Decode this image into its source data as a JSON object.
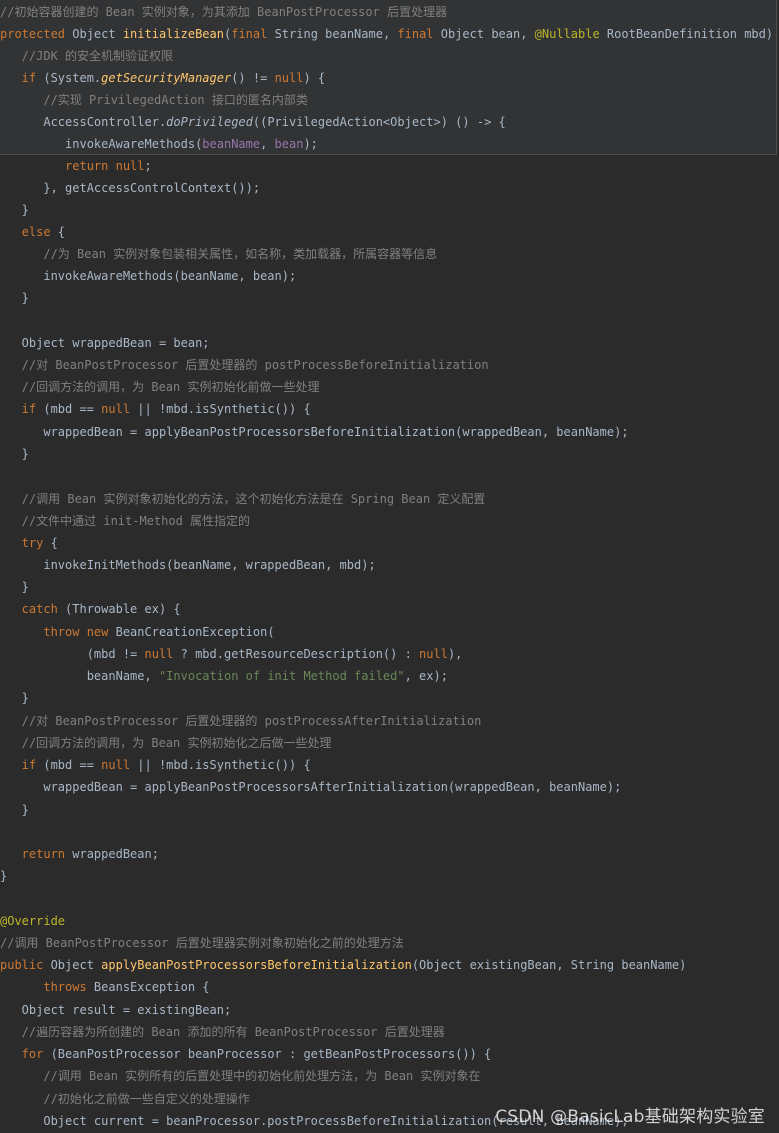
{
  "lines": [
    {
      "c": "comment",
      "t": "//初始容器创建的 Bean 实例对象，为其添加 BeanPostProcessor 后置处理器"
    },
    {
      "c": "",
      "t": ""
    },
    {
      "c": "comment",
      "t": "   //JDK 的安全机制验证权限"
    },
    {
      "c": "",
      "t": ""
    },
    {
      "c": "comment",
      "t": "      //实现 PrivilegedAction 接口的匿名内部类"
    },
    {
      "c": "",
      "t": ""
    },
    {
      "c": "",
      "t": ""
    },
    {
      "c": "",
      "t": ""
    },
    {
      "c": "",
      "t": ""
    },
    {
      "c": "",
      "t": ""
    },
    {
      "c": "",
      "t": ""
    },
    {
      "c": "comment",
      "t": "      //为 Bean 实例对象包装相关属性，如名称，类加载器，所属容器等信息"
    },
    {
      "c": "",
      "t": ""
    },
    {
      "c": "",
      "t": ""
    },
    {
      "c": "",
      "t": ""
    },
    {
      "c": "",
      "t": ""
    },
    {
      "c": "comment",
      "t": "   //对 BeanPostProcessor 后置处理器的 postProcessBeforeInitialization"
    },
    {
      "c": "comment",
      "t": "   //回调方法的调用，为 Bean 实例初始化前做一些处理"
    },
    {
      "c": "",
      "t": ""
    },
    {
      "c": "",
      "t": ""
    },
    {
      "c": "",
      "t": ""
    },
    {
      "c": "",
      "t": ""
    },
    {
      "c": "comment",
      "t": "   //调用 Bean 实例对象初始化的方法，这个初始化方法是在 Spring Bean 定义配置"
    },
    {
      "c": "comment",
      "t": "   //文件中通过 init-Method 属性指定的"
    }
  ],
  "code": {
    "l1": {
      "kw": "protected",
      "type": " Object ",
      "fn": "initializeBean",
      "p1": "(",
      "kw2": "final",
      "t2": " String beanName, ",
      "kw3": "final",
      "t3": " Object bean, ",
      "anno": "@Nullable",
      "t4": " RootBeanDefinition mbd) {"
    },
    "l3": {
      "kw": "   if",
      "t1": " (System.",
      "fn": "getSecurityManager",
      "t2": "() != ",
      "kw2": "null",
      "t3": ") {"
    },
    "l5": {
      "t1": "      AccessController.",
      "fn": "doPrivileged",
      "t2": "((PrivilegedAction<Object>) () -> {"
    },
    "l6": {
      "t1": "         invokeAwareMethods(",
      "p1": "beanName",
      "t2": ", ",
      "p2": "bean",
      "t3": ");"
    },
    "l7": {
      "kw": "         return null",
      "t1": ";"
    },
    "l8": {
      "t1": "      }, getAccessControlContext());"
    },
    "l9": {
      "t1": "   }"
    },
    "l10": {
      "kw": "   else",
      "t1": " {"
    },
    "l12": {
      "t1": "      invokeAwareMethods(beanName, bean);"
    },
    "l13": {
      "t1": "   }"
    },
    "l15": {
      "t1": "   Object wrappedBean = bean;"
    },
    "l18": {
      "kw": "   if",
      "t1": " (mbd == ",
      "kw2": "null",
      "t2": " || !mbd.isSynthetic()) {"
    },
    "l19": {
      "t1": "      wrappedBean = applyBeanPostProcessorsBeforeInitialization(wrappedBean, beanName);"
    },
    "l20": {
      "t1": "   }"
    },
    "l24": {
      "kw": "   try",
      "t1": " {"
    },
    "l25": {
      "t1": "      invokeInitMethods(beanName, wrappedBean, mbd);"
    },
    "l26": {
      "t1": "   }"
    },
    "l27": {
      "kw": "   catch",
      "t1": " (Throwable ex) {"
    },
    "l28": {
      "kw": "      throw new",
      "t1": " BeanCreationException("
    },
    "l29": {
      "t1": "            (mbd != ",
      "kw": "null",
      "t2": " ? mbd.getResourceDescription() : ",
      "kw2": "null",
      "t3": "),"
    },
    "l30": {
      "t1": "            beanName, ",
      "str": "\"Invocation of init Method failed\"",
      "t2": ", ex);"
    },
    "l31": {
      "t1": "   }"
    },
    "l32": {
      "c": "   //对 BeanPostProcessor 后置处理器的 postProcessAfterInitialization"
    },
    "l33": {
      "c": "   //回调方法的调用，为 Bean 实例初始化之后做一些处理"
    },
    "l34": {
      "kw": "   if",
      "t1": " (mbd == ",
      "kw2": "null",
      "t2": " || !mbd.isSynthetic()) {"
    },
    "l35": {
      "t1": "      wrappedBean = applyBeanPostProcessorsAfterInitialization(wrappedBean, beanName);"
    },
    "l36": {
      "t1": "   }"
    },
    "l38": {
      "kw": "   return",
      "t1": " wrappedBean;"
    },
    "l39": {
      "t1": "}"
    },
    "l41": {
      "anno": "@Override"
    },
    "l42": {
      "c": "//调用 BeanPostProcessor 后置处理器实例对象初始化之前的处理方法"
    },
    "l43": {
      "kw": "public",
      "t1": " Object ",
      "fn": "applyBeanPostProcessorsBeforeInitialization",
      "t2": "(Object existingBean, String beanName)"
    },
    "l44": {
      "kw": "      throws",
      "t1": " BeansException {"
    },
    "l45": {
      "t1": "   Object result = existingBean;"
    },
    "l46": {
      "c": "   //遍历容器为所创建的 Bean 添加的所有 BeanPostProcessor 后置处理器"
    },
    "l47": {
      "kw": "   for",
      "t1": " (BeanPostProcessor beanProcessor : getBeanPostProcessors()) {"
    },
    "l48": {
      "c": "      //调用 Bean 实例所有的后置处理中的初始化前处理方法，为 Bean 实例对象在"
    },
    "l49": {
      "c": "      //初始化之前做一些自定义的处理操作"
    },
    "l50": {
      "t1": "      Object current = beanProcessor.postProcessBeforeInitialization(result, beanName);"
    }
  },
  "watermark": "CSDN @BasicLab基础架构实验室"
}
